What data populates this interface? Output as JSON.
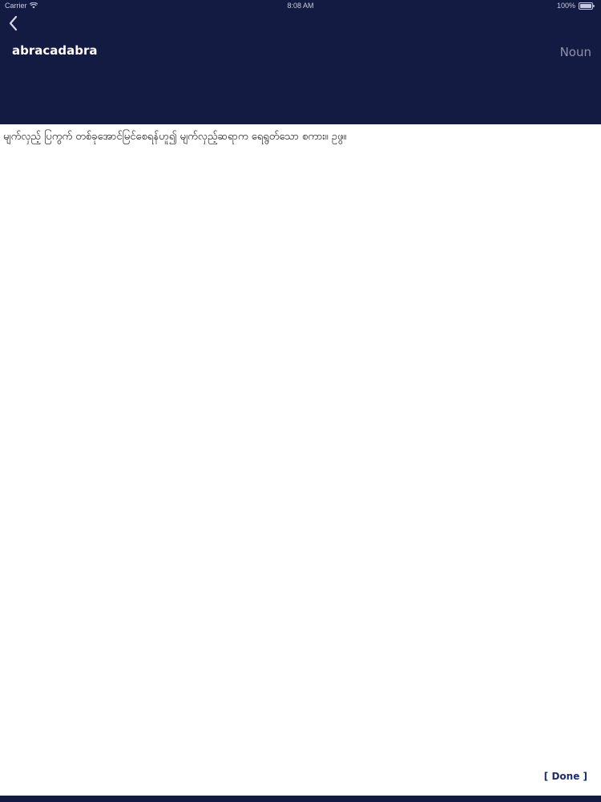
{
  "status_bar": {
    "carrier": "Carrier",
    "time": "8:08 AM",
    "battery": "100%"
  },
  "header": {
    "back_icon": "chevron-left-icon",
    "word": "abracadabra",
    "part_of_speech": "Noun"
  },
  "definition": {
    "text": "မျက်လှည့် ပြကွက် တစ်ခုအောင်မြင်စေရန်ဟူ၍ မျက်လှည့်ဆရာက ရေရွတ်သော စကား။ ဥဖွ။"
  },
  "footer": {
    "done_label": "[ Done ]"
  },
  "colors": {
    "header_bg": "#141b43",
    "title_text": "#ffffff",
    "part_of_speech_text": "#8e92ad",
    "done_text": "#1d2d6b"
  }
}
